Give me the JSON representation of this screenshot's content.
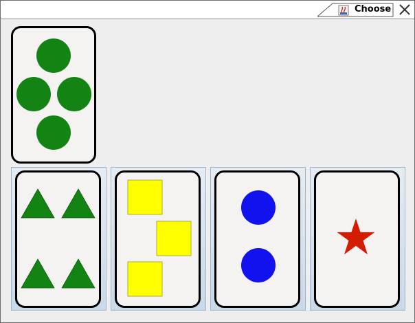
{
  "window": {
    "tab_label": "Choose",
    "tab_icon": "java-app-icon",
    "close_icon": "close-icon"
  },
  "deal_card": {
    "shape": "circle",
    "color": "#138413",
    "count": 4
  },
  "choices": [
    {
      "shape": "triangle",
      "color": "#138413",
      "count": 4
    },
    {
      "shape": "square",
      "color": "#ffff00",
      "count": 3
    },
    {
      "shape": "circle",
      "color": "#1212ef",
      "count": 2
    },
    {
      "shape": "star",
      "color": "#d41c00",
      "count": 1
    }
  ],
  "colors": {
    "slot_top": "#e5ecf3",
    "slot_bottom": "#c9d9e8",
    "card_bg": "#f4f3f2"
  }
}
